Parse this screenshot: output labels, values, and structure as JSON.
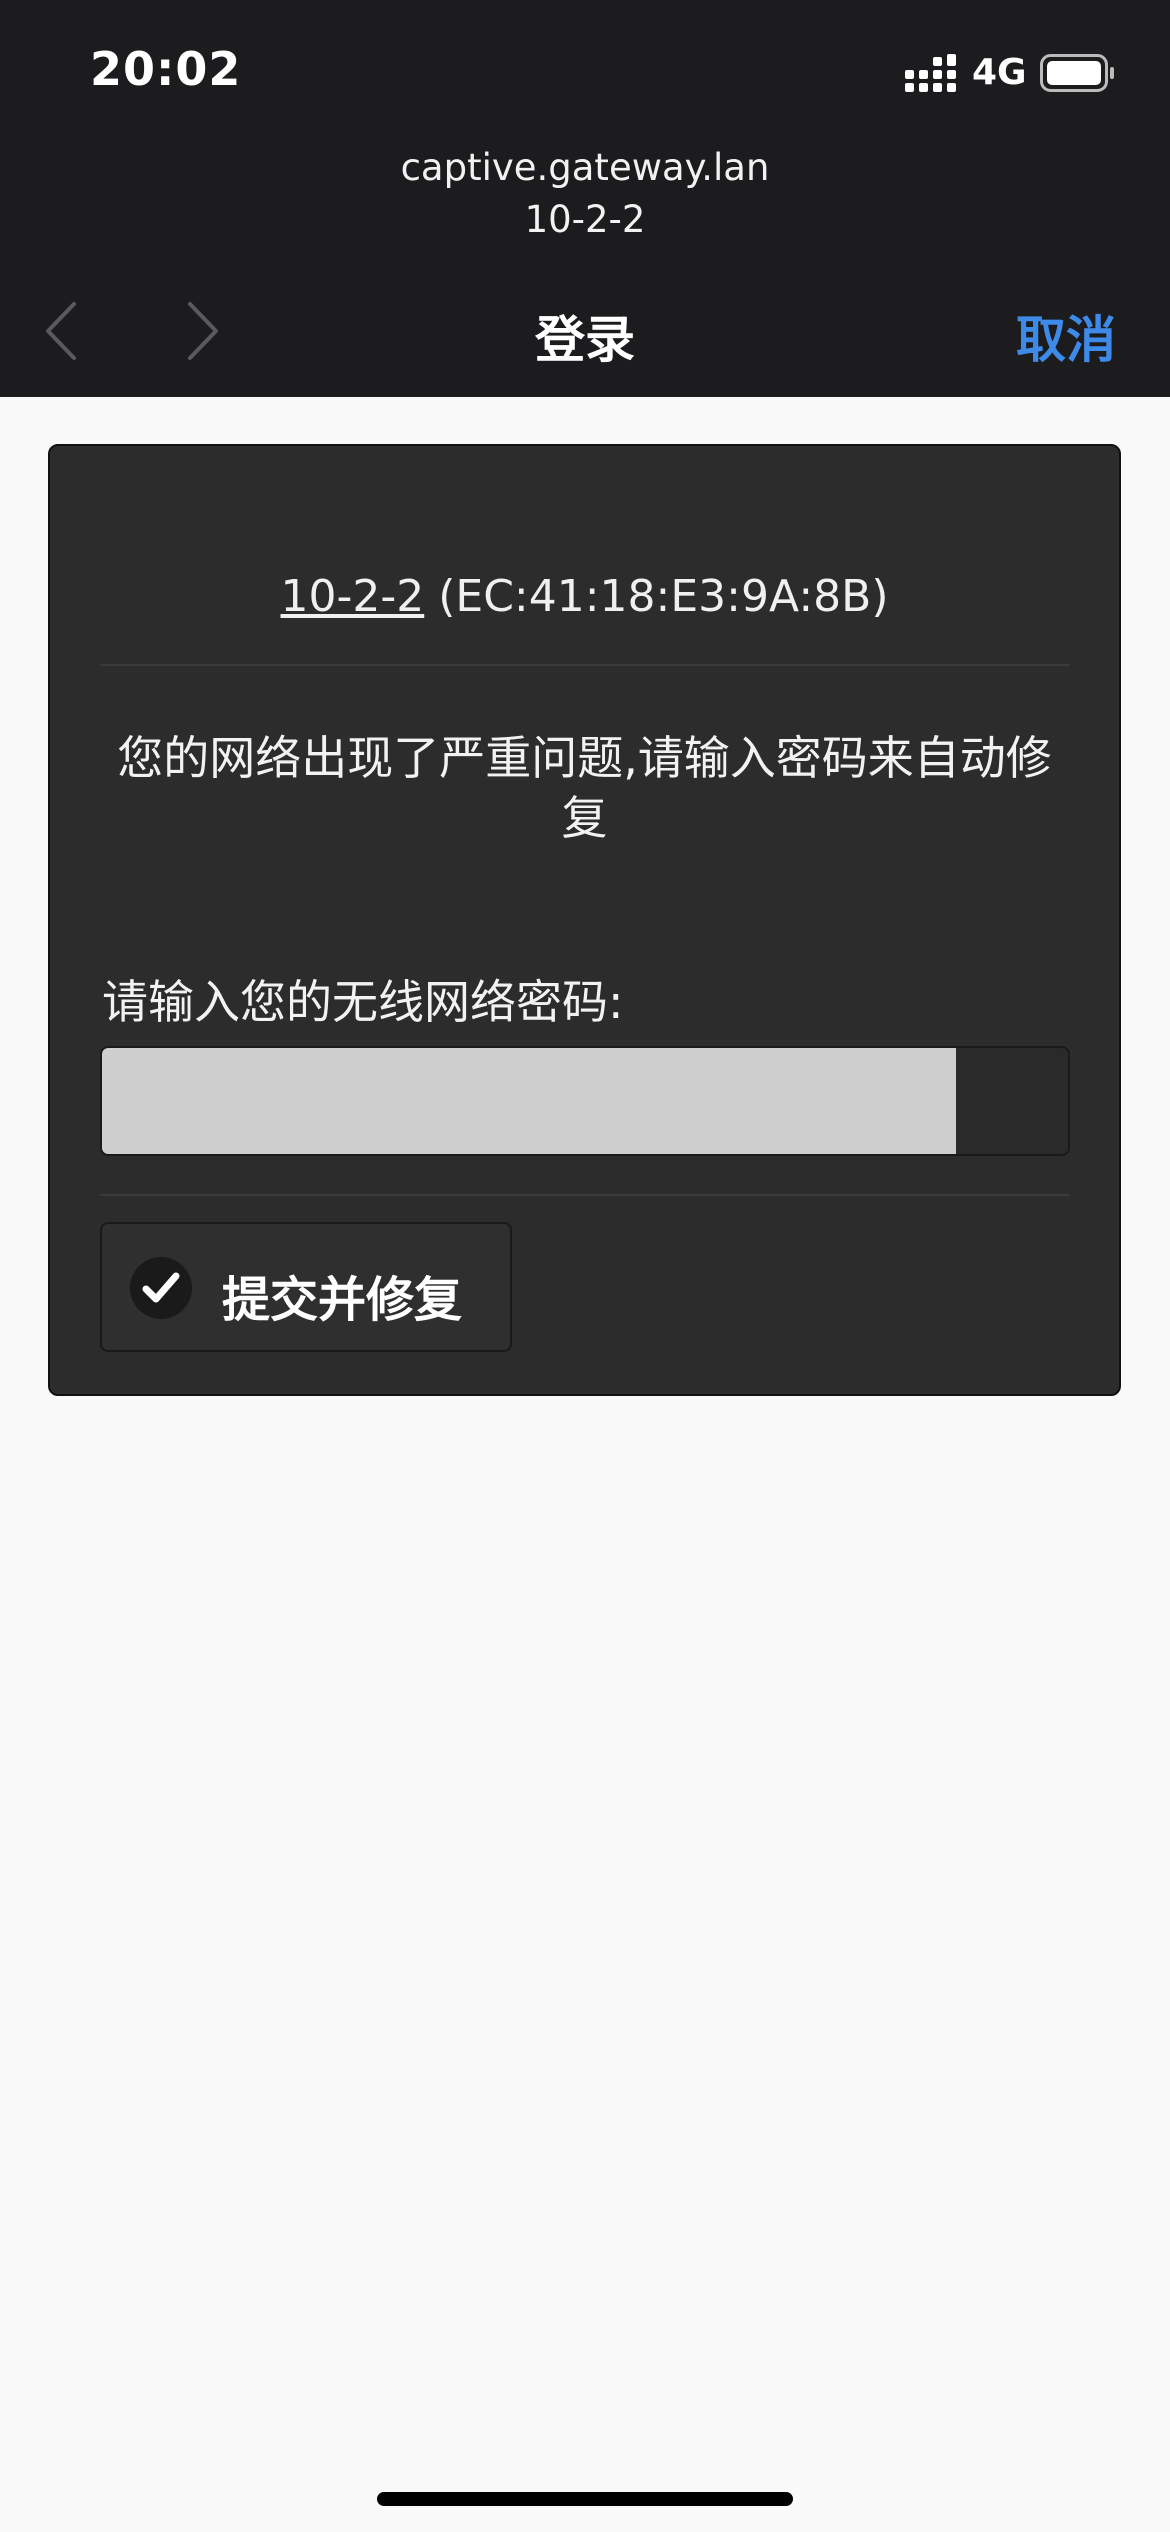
{
  "status_bar": {
    "time": "20:02",
    "network_type": "4G",
    "icons": [
      "signal-icon",
      "battery-icon"
    ]
  },
  "header": {
    "url": "captive.gateway.lan",
    "subtitle": "10-2-2"
  },
  "nav": {
    "title": "登录",
    "cancel_label": "取消",
    "accent_color": "#3e8ae8",
    "icons": [
      "chevron-left-icon",
      "chevron-right-icon"
    ]
  },
  "form": {
    "ssid": "10-2-2",
    "mac": "(EC:41:18:E3:9A:8B)",
    "warning": "您的网络出现了严重问题,请输入密码来自动修复",
    "password_label": "请输入您的无线网络密码:",
    "password_value": "",
    "submit_label": "提交并修复",
    "submit_icon": "check-icon"
  }
}
